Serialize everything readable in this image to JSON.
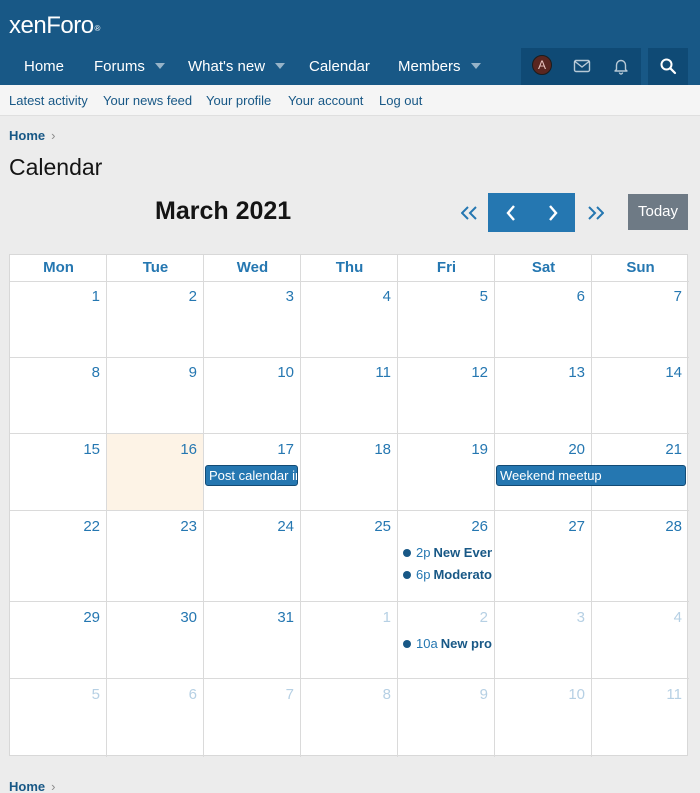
{
  "header": {
    "logo_text": "xenForo",
    "logo_mark": "®"
  },
  "nav": {
    "items": [
      {
        "label": "Home"
      },
      {
        "label": "Forums"
      },
      {
        "label": "What's new"
      },
      {
        "label": "Calendar"
      },
      {
        "label": "Members"
      }
    ],
    "avatar_letter": "A"
  },
  "subnav": {
    "items": [
      {
        "label": "Latest activity"
      },
      {
        "label": "Your news feed"
      },
      {
        "label": "Your profile"
      },
      {
        "label": "Your account"
      },
      {
        "label": "Log out"
      }
    ]
  },
  "breadcrumb": {
    "home": "Home",
    "chevron": "›"
  },
  "page_title": "Calendar",
  "calendar": {
    "month_title": "March 2021",
    "prev_year": "«",
    "prev": "‹",
    "next": "›",
    "next_year": "»",
    "today_label": "Today",
    "days_of_week": [
      "Mon",
      "Tue",
      "Wed",
      "Thu",
      "Fri",
      "Sat",
      "Sun"
    ],
    "weeks": [
      [
        "1",
        "2",
        "3",
        "4",
        "5",
        "6",
        "7"
      ],
      [
        "8",
        "9",
        "10",
        "11",
        "12",
        "13",
        "14"
      ],
      [
        "15",
        "16",
        "17",
        "18",
        "19",
        "20",
        "21"
      ],
      [
        "22",
        "23",
        "24",
        "25",
        "26",
        "27",
        "28"
      ],
      [
        "29",
        "30",
        "31",
        "1",
        "2",
        "3",
        "4"
      ],
      [
        "5",
        "6",
        "7",
        "8",
        "9",
        "10",
        "11"
      ]
    ],
    "event_bars": [
      {
        "title": "Post calendar in"
      },
      {
        "title": "Weekend meetup"
      }
    ],
    "event_items": [
      {
        "time": "2p",
        "title": "New Even"
      },
      {
        "time": "6p",
        "title": "Moderato"
      },
      {
        "time": "10a",
        "title": "New pro"
      }
    ]
  },
  "footer_breadcrumb": {
    "home": "Home",
    "chevron": "›"
  },
  "colors": {
    "header": "#185886",
    "accent": "#2577b1",
    "today_bg": "#fdf3e6",
    "today_button": "#6e7a85"
  }
}
